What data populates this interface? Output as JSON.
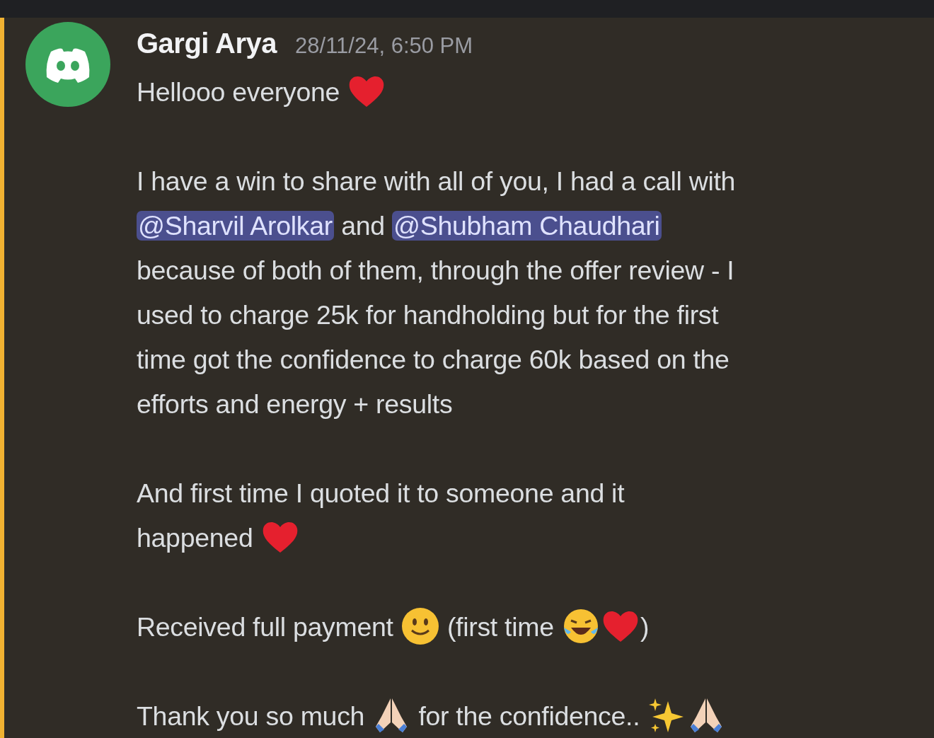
{
  "message": {
    "author": "Gargi Arya",
    "timestamp": "28/11/24, 6:50 PM",
    "paragraphs": [
      [
        {
          "kind": "text",
          "text": "Hellooo everyone "
        },
        {
          "kind": "heart"
        }
      ],
      [
        {
          "kind": "text",
          "text": "I have a win to share with all of you, I had a call with "
        },
        {
          "kind": "mention",
          "text": "@Sharvil Arolkar"
        },
        {
          "kind": "text",
          "text": " and "
        },
        {
          "kind": "mention",
          "text": "@Shubham Chaudhari"
        },
        {
          "kind": "text",
          "text": " because of both of them, through the offer review - I used to charge 25k for handholding but for the first time got the confidence to charge 60k based on the efforts and energy + results"
        }
      ],
      [
        {
          "kind": "text",
          "text": "And first time I quoted it to someone and it happened "
        },
        {
          "kind": "heart"
        }
      ],
      [
        {
          "kind": "text",
          "text": "Received full payment "
        },
        {
          "kind": "smile"
        },
        {
          "kind": "text",
          "text": " (first time "
        },
        {
          "kind": "laugh"
        },
        {
          "kind": "heart"
        },
        {
          "kind": "text",
          "text": ")"
        }
      ],
      [
        {
          "kind": "text",
          "text": "Thank you so much "
        },
        {
          "kind": "pray"
        },
        {
          "kind": "text",
          "text": " for the confidence.. "
        },
        {
          "kind": "sparkles"
        },
        {
          "kind": "pray"
        }
      ]
    ]
  }
}
